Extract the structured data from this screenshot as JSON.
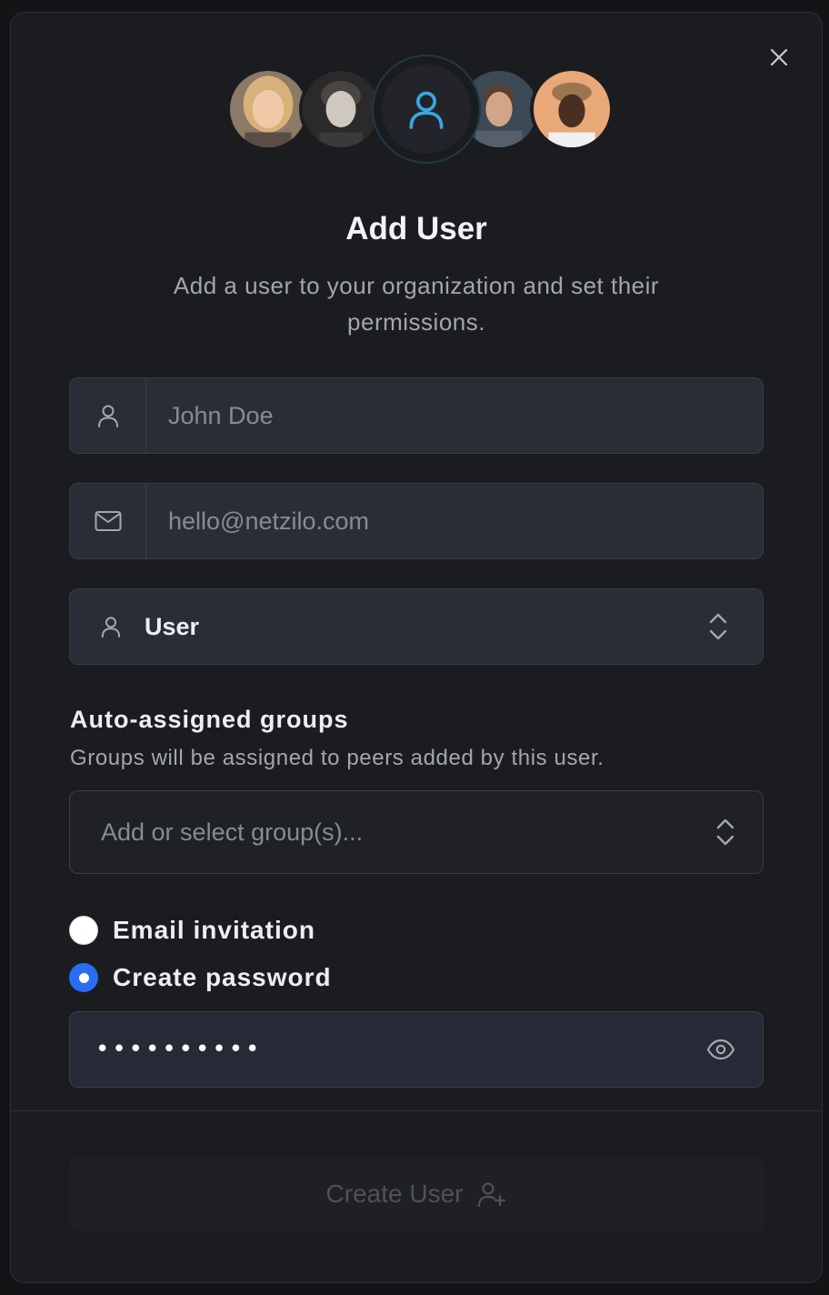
{
  "dialog": {
    "title": "Add User",
    "subtitle": "Add a user to your organization and set their permissions."
  },
  "icons": {
    "close": "close-icon",
    "center_avatar": "user-icon",
    "name_prefix": "user-icon",
    "email_prefix": "mail-icon",
    "role_prefix": "user-icon",
    "role_chevron": "chevron-up-down-icon",
    "groups_chevron": "chevron-up-down-icon",
    "password_toggle": "eye-icon",
    "create_button": "user-plus-icon"
  },
  "form": {
    "name": {
      "placeholder": "John Doe",
      "value": ""
    },
    "email": {
      "placeholder": "hello@netzilo.com",
      "value": ""
    },
    "role": {
      "value": "User"
    },
    "groups": {
      "label": "Auto-assigned groups",
      "help": "Groups will be assigned to peers added by this user.",
      "placeholder": "Add or select group(s)..."
    },
    "auth_options": [
      {
        "label": "Email invitation",
        "selected": false
      },
      {
        "label": "Create password",
        "selected": true
      }
    ],
    "password": {
      "masked_value": "••••••••••"
    }
  },
  "footer": {
    "create_label": "Create User"
  },
  "colors": {
    "background": "#1b1c20",
    "accent": "#2b6cf0",
    "icon_blue": "#3aa7e0"
  }
}
